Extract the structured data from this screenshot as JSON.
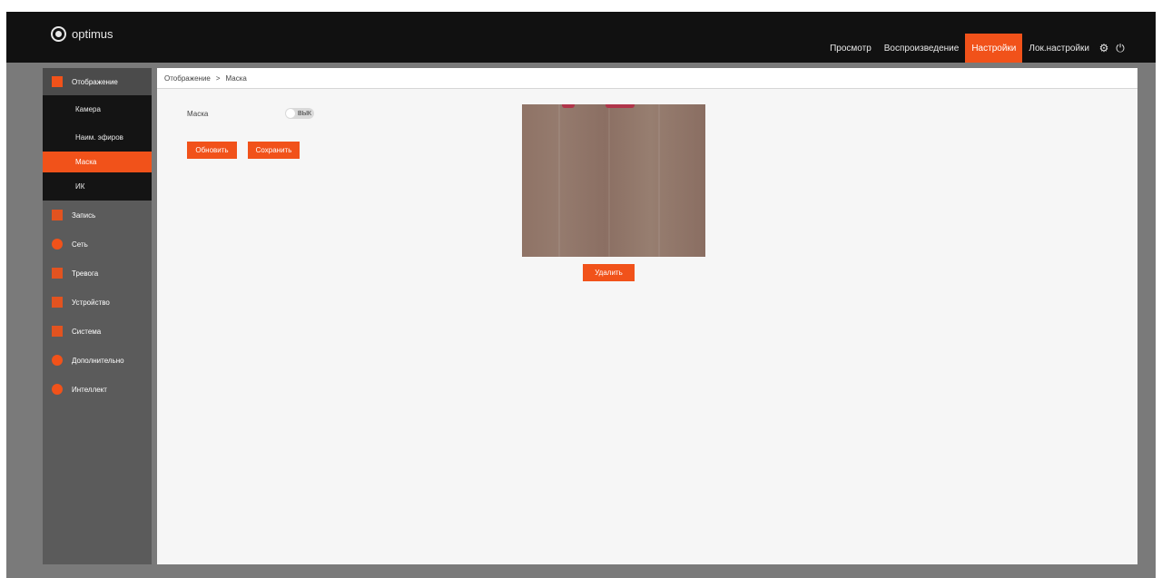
{
  "app": {
    "logo_text": "optimus"
  },
  "topnav": {
    "items": [
      {
        "label": "Просмотр",
        "active": false
      },
      {
        "label": "Воспроизведение",
        "active": false
      },
      {
        "label": "Настройки",
        "active": true
      },
      {
        "label": "Лок.настройки",
        "active": false
      }
    ],
    "icons": [
      "gear-icon",
      "power-icon"
    ]
  },
  "sidebar": {
    "section": {
      "label": "Отображение",
      "icon": "display-icon"
    },
    "sub_items": [
      {
        "label": "Камера",
        "active": false
      },
      {
        "label": "Наим. эфиров",
        "active": false
      },
      {
        "label": "Маска",
        "active": true
      },
      {
        "label": "ИК",
        "active": false
      }
    ],
    "items": [
      {
        "label": "Запись",
        "icon": "record-icon"
      },
      {
        "label": "Сеть",
        "icon": "network-icon"
      },
      {
        "label": "Тревога",
        "icon": "alarm-icon"
      },
      {
        "label": "Устройство",
        "icon": "device-icon"
      },
      {
        "label": "Система",
        "icon": "system-icon"
      },
      {
        "label": "Дополнительно",
        "icon": "advanced-icon"
      },
      {
        "label": "Интеллект",
        "icon": "intelligence-icon"
      }
    ]
  },
  "breadcrumb": {
    "root": "Отображение",
    "separator": ">",
    "current": "Маска"
  },
  "mask": {
    "label": "Маска",
    "toggle_text": "ВЫК",
    "enabled": false
  },
  "buttons": {
    "refresh": "Обновить",
    "save": "Сохранить",
    "clear": "Удалить"
  },
  "colors": {
    "accent": "#f1521a",
    "topbar": "#111111",
    "sidebar": "#5b5b5b"
  }
}
